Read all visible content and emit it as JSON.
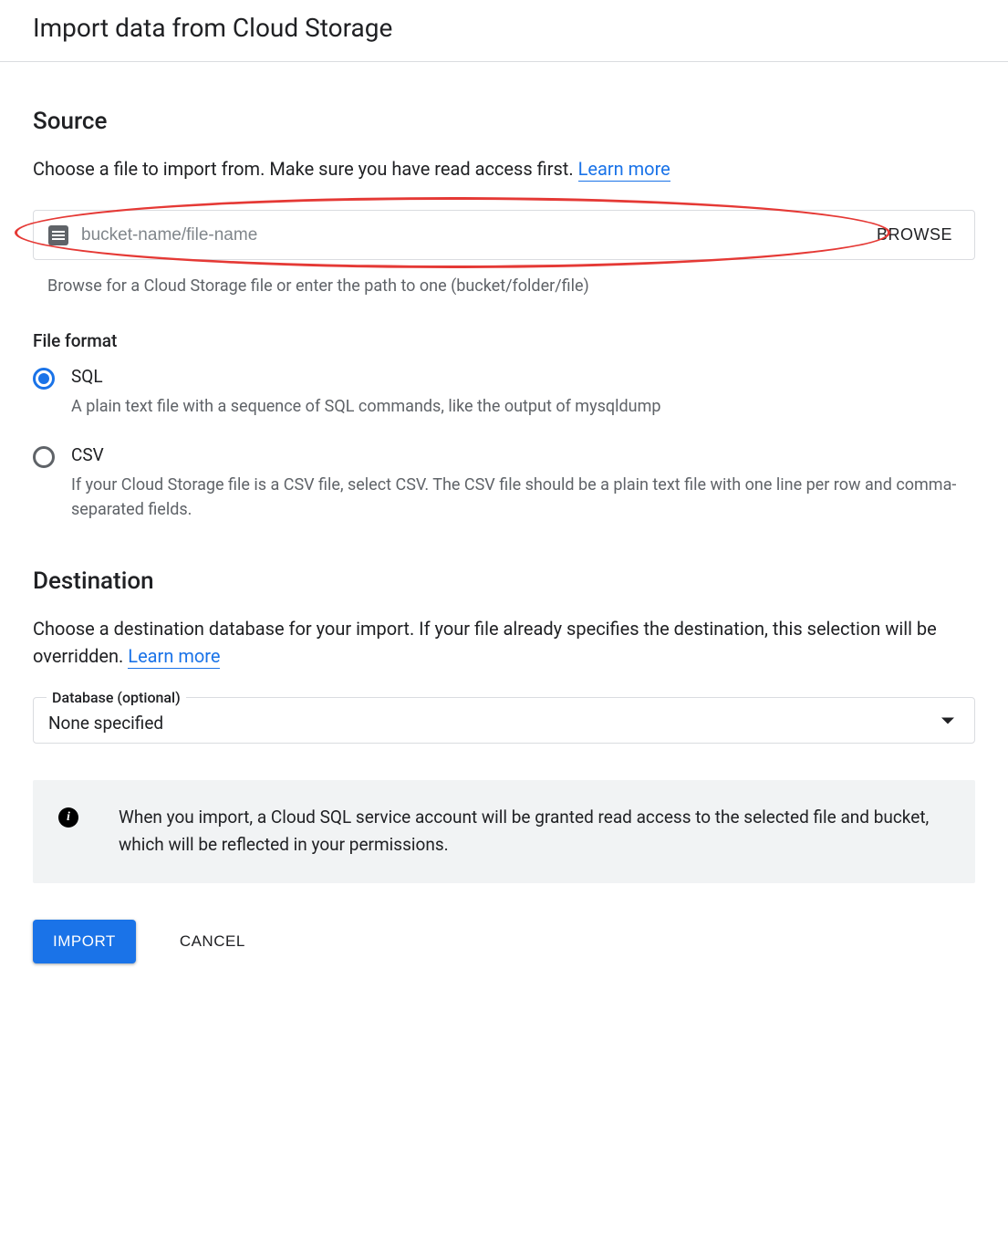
{
  "header": {
    "title": "Import data from Cloud Storage"
  },
  "source": {
    "heading": "Source",
    "description_prefix": "Choose a file to import from. Make sure you have read access first. ",
    "learn_more": "Learn more",
    "file_input_placeholder": "bucket-name/file-name",
    "file_input_value": "",
    "browse_label": "BROWSE",
    "helper_text": "Browse for a Cloud Storage file or enter the path to one (bucket/folder/file)"
  },
  "file_format": {
    "heading": "File format",
    "options": [
      {
        "value": "sql",
        "label": "SQL",
        "selected": true,
        "description": "A plain text file with a sequence of SQL commands, like the output of mysqldump"
      },
      {
        "value": "csv",
        "label": "CSV",
        "selected": false,
        "description": "If your Cloud Storage file is a CSV file, select CSV. The CSV file should be a plain text file with one line per row and comma-separated fields."
      }
    ]
  },
  "destination": {
    "heading": "Destination",
    "description_prefix": "Choose a destination database for your import. If your file already specifies the destination, this selection will be overridden. ",
    "learn_more": "Learn more",
    "select_label": "Database (optional)",
    "select_value": "None specified"
  },
  "info_note": "When you import, a Cloud SQL service account will be granted read access to the selected file and bucket, which will be reflected in your permissions.",
  "buttons": {
    "import": "IMPORT",
    "cancel": "CANCEL"
  },
  "annotation": {
    "circled_element": "source-file-field"
  }
}
